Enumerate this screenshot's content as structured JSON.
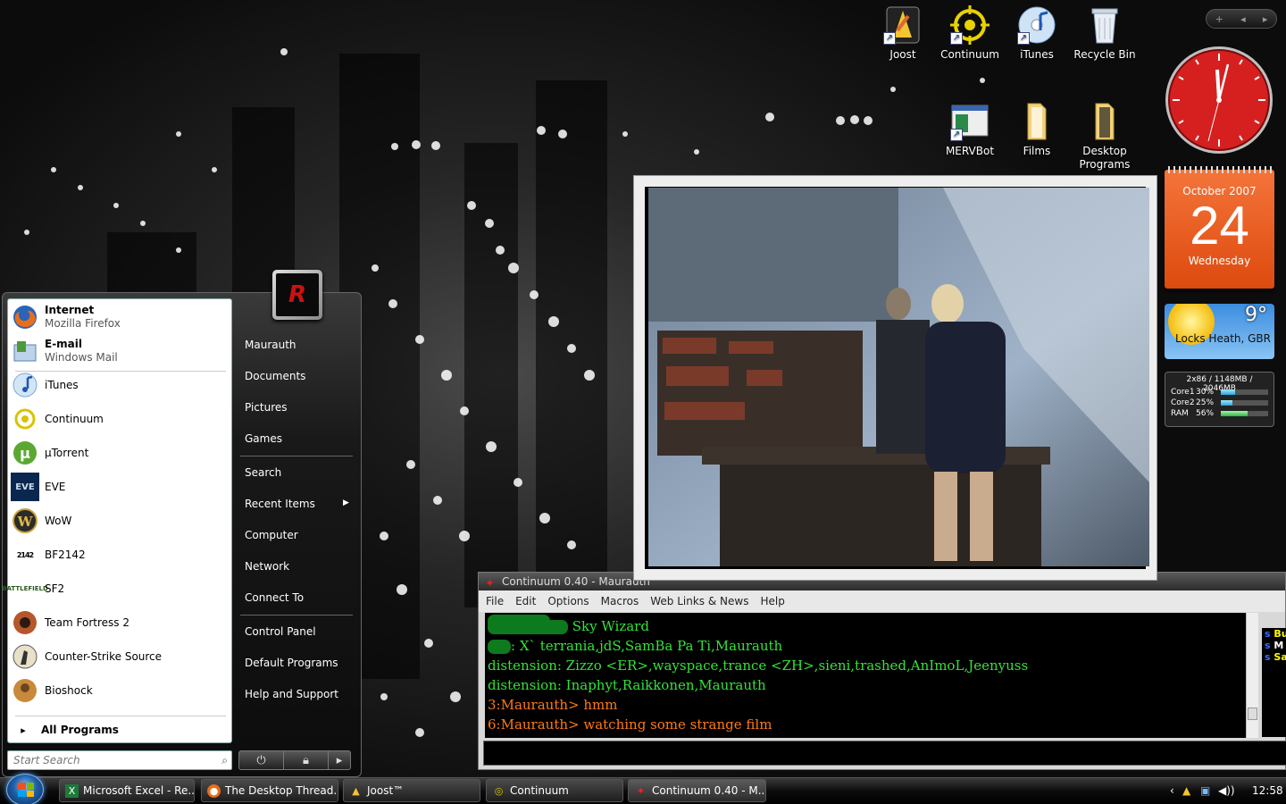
{
  "desktop": {
    "icons": [
      {
        "label": "Joost",
        "icon": "joost-icon"
      },
      {
        "label": "Continuum",
        "icon": "continuum-icon"
      },
      {
        "label": "iTunes",
        "icon": "itunes-icon"
      },
      {
        "label": "Recycle Bin",
        "icon": "recycle-bin-icon"
      },
      {
        "label": "MERVBot",
        "icon": "mervbot-icon"
      },
      {
        "label": "Films",
        "icon": "folder-icon"
      },
      {
        "label": "Desktop Programs",
        "icon": "folder-icon"
      }
    ]
  },
  "gadgets": {
    "toolbar": {
      "add": "+",
      "prev": "◂",
      "next": "▸"
    },
    "calendar": {
      "month": "October 2007",
      "day": "24",
      "weekday": "Wednesday"
    },
    "weather": {
      "temp": "9°",
      "location": "Locks Heath, GBR"
    },
    "meter": {
      "header": "2x86 / 1148MB / 2046MB",
      "rows": [
        {
          "label": "Core1",
          "value": "30%",
          "level": 0.3
        },
        {
          "label": "Core2",
          "value": "25%",
          "level": 0.25
        },
        {
          "label": "RAM",
          "value": "56%",
          "level": 0.56
        }
      ]
    }
  },
  "chat": {
    "title": "Continuum 0.40 - Maurauth",
    "menu": [
      "File",
      "Edit",
      "Options",
      "Macros",
      "Web Links & News",
      "Help"
    ],
    "lines": [
      {
        "prefix": "",
        "text": "Sky Wizard",
        "color": "green"
      },
      {
        "prefix": "",
        "text": ": X` terrania,jdS,SamBa Pa Ti,Maurauth",
        "color": "green"
      },
      {
        "prefix": "",
        "text": "distension: Zizzo <ER>,wayspace,trance <ZH>,sieni,trashed,AnImoL,Jeenyuss",
        "color": "green"
      },
      {
        "prefix": "",
        "text": "distension: Inaphyt,Raikkonen,Maurauth",
        "color": "green"
      },
      {
        "prefix": "",
        "text": "3:Maurauth> hmm",
        "color": "orange"
      },
      {
        "prefix": "",
        "text": "6:Maurauth> watching some strange film",
        "color": "orange"
      }
    ],
    "nicklist": [
      "Bu",
      "M",
      "Sa"
    ],
    "colors": {
      "green": "#34e238",
      "orange": "#ff7a14"
    }
  },
  "startmenu": {
    "pinned": [
      {
        "name": "Internet",
        "sub": "Mozilla Firefox",
        "icon": "firefox-icon"
      },
      {
        "name": "E-mail",
        "sub": "Windows Mail",
        "icon": "mail-icon"
      }
    ],
    "recent": [
      {
        "name": "iTunes",
        "icon": "itunes-icon"
      },
      {
        "name": "Continuum",
        "icon": "continuum-icon"
      },
      {
        "name": "µTorrent",
        "icon": "utorrent-icon"
      },
      {
        "name": "EVE",
        "icon": "eve-icon"
      },
      {
        "name": "WoW",
        "icon": "wow-icon"
      },
      {
        "name": "BF2142",
        "icon": "bf2142-icon"
      },
      {
        "name": "SF2",
        "icon": "sf2-icon"
      },
      {
        "name": "Team Fortress 2",
        "icon": "tf2-icon"
      },
      {
        "name": "Counter-Strike Source",
        "icon": "css-icon"
      },
      {
        "name": "Bioshock",
        "icon": "bioshock-icon"
      }
    ],
    "all_programs": "All Programs",
    "search_placeholder": "Start Search",
    "right": [
      "Maurauth",
      "Documents",
      "Pictures",
      "Games",
      "Search",
      "Recent Items",
      "Computer",
      "Network",
      "Connect To",
      "Control Panel",
      "Default Programs",
      "Help and Support"
    ]
  },
  "taskbar": {
    "buttons": [
      {
        "label": "Microsoft Excel - Re...",
        "icon": "excel-icon"
      },
      {
        "label": "The Desktop Thread...",
        "icon": "firefox-icon"
      },
      {
        "label": "Joost™",
        "icon": "joost-icon"
      },
      {
        "label": "Continuum",
        "icon": "continuum-icon"
      },
      {
        "label": "Continuum 0.40 - M...",
        "icon": "continuum-red-icon"
      }
    ],
    "clock": "12:58"
  }
}
